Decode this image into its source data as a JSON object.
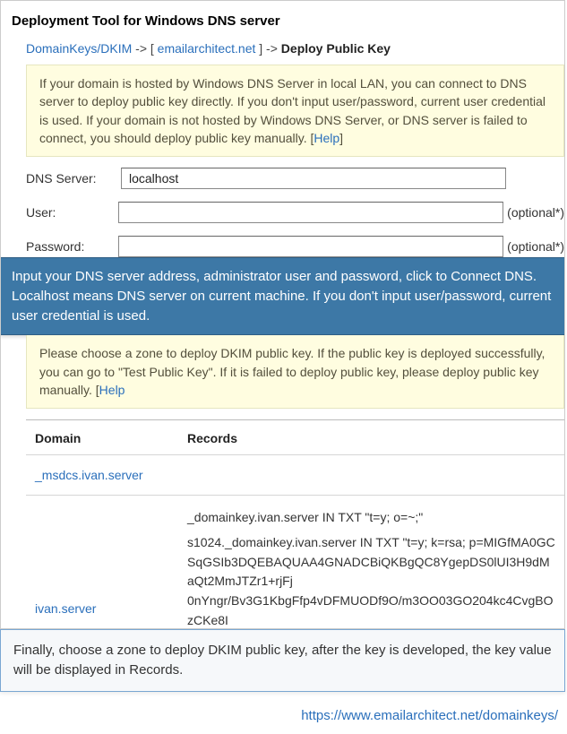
{
  "title": "Deployment Tool for Windows DNS server",
  "breadcrumb": {
    "part1": "DomainKeys/DKIM",
    "sep1": " -> [ ",
    "part2": "emailarchitect.net",
    "sep2": " ] -> ",
    "current": "Deploy Public Key"
  },
  "info1": {
    "text": "If your domain is hosted by Windows DNS Server in local LAN, you can connect to DNS server to deploy public key directly. If you don't input user/password, current user credential is used. If your domain is not hosted by Windows DNS Server, or DNS server is failed to connect, you should deploy public key manually. [",
    "help": "Help",
    "close": "]"
  },
  "form": {
    "dns_label": "DNS Server:",
    "dns_value": "localhost",
    "user_label": "User:",
    "user_value": "",
    "pass_label": "Password:",
    "pass_value": "",
    "optional": "(optional*)"
  },
  "callout_blue": "Input your DNS server address, administrator user and password, click to Connect DNS. Localhost means DNS server on current machine. If you don't input user/password, current user credential is used.",
  "info2": {
    "text": "Please choose a zone to deploy DKIM public key. If the public key is deployed successfully, you can go to \"Test Public Key\". If it is failed to deploy public key, please deploy public key manually. [",
    "help": "Help",
    "close": ""
  },
  "table": {
    "col_domain": "Domain",
    "col_records": "Records",
    "rows": [
      {
        "domain": "_msdcs.ivan.server",
        "records": []
      },
      {
        "domain": "ivan.server",
        "records": [
          "_domainkey.ivan.server IN TXT \"t=y; o=~;\"",
          "s1024._domainkey.ivan.server IN TXT \"t=y; k=rsa; p=MIGfMA0GCSqGSIb3DQEBAQUAA4GNADCBiQKBgQC8YgepDS0lUI3H9dMaQt2MmJTZr1+rjFj"
        ],
        "records_cut": "0nYngr/Bv3G1KbgFfp4vDFMUODf9O/m3OO03GO204kc4CvgBOzCKe8I"
      }
    ]
  },
  "final_note": "Finally, choose a zone to deploy DKIM public key, after the key is developed, the key value will be displayed in Records.",
  "footer_url": "https://www.emailarchitect.net/domainkeys/"
}
